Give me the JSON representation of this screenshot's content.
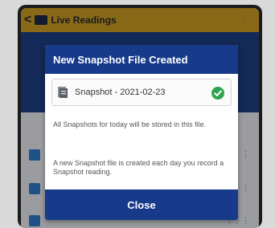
{
  "app": {
    "back_label": "<",
    "title": "Live Readings",
    "menu_label": "⋮"
  },
  "dialog": {
    "title": "New Snapshot File Created",
    "file_name": "Snapshot - 2021-02-23",
    "status": "created",
    "desc1": "All Snapshots for today will be stored in this file.",
    "desc2": "A new Snapshot file is created each day you record a Snapshot reading.",
    "close_label": "Close"
  },
  "colors": {
    "accent": "#173a8a",
    "topbar": "#cfa125",
    "success": "#2ea44f"
  },
  "icons": [
    "camera-icon",
    "file-icon",
    "check-circle-icon",
    "more-icon"
  ]
}
